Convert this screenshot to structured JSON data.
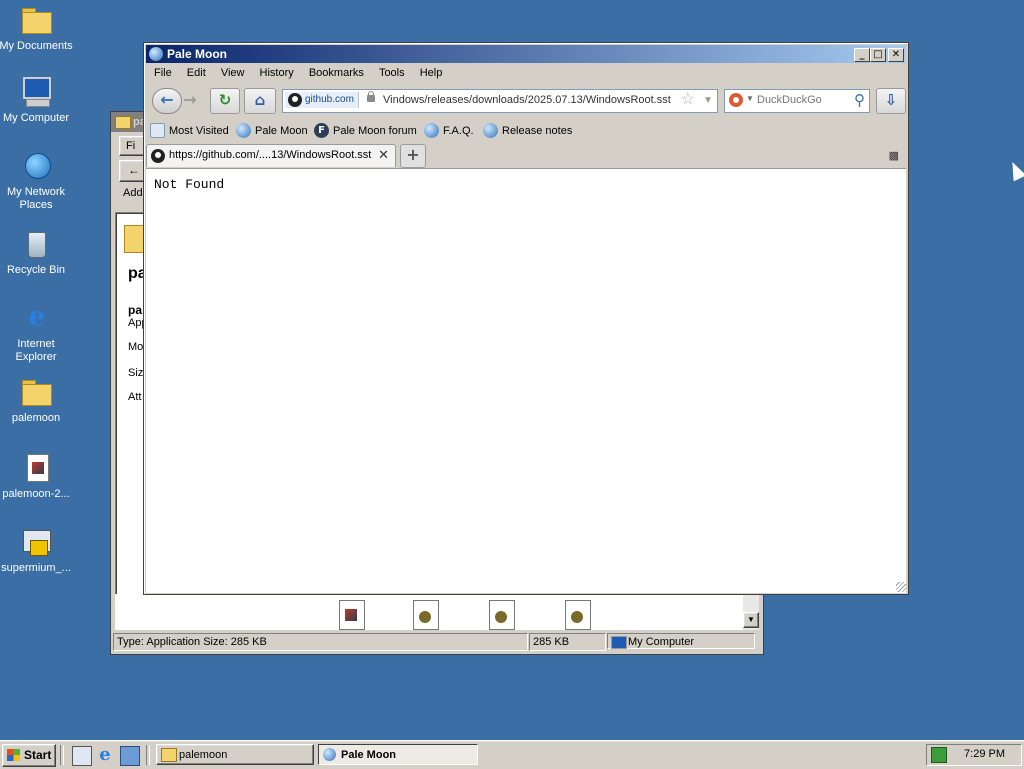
{
  "desktop": {
    "icons": [
      {
        "label": "My Documents",
        "icon": "my-documents-icon"
      },
      {
        "label": "My Computer",
        "icon": "my-computer-icon"
      },
      {
        "label": "My Network Places",
        "icon": "network-places-icon"
      },
      {
        "label": "Recycle Bin",
        "icon": "recycle-bin-icon"
      },
      {
        "label": "Internet Explorer",
        "icon": "internet-explorer-icon"
      },
      {
        "label": "palemoon",
        "icon": "folder-icon"
      },
      {
        "label": "palemoon-2...",
        "icon": "installer-icon"
      },
      {
        "label": "supermium_...",
        "icon": "setup-icon"
      }
    ]
  },
  "explorer": {
    "title": "pa",
    "menu_partial": "Fi",
    "address_partial": "Add",
    "left_pane": {
      "name_partial": "pa",
      "type_partial": "App",
      "modified_partial": "Mo",
      "size_partial": "Size",
      "attributes_partial": "Att"
    },
    "status": {
      "info": "Type: Application Size: 285 KB",
      "size": "285 KB",
      "zone": "My Computer"
    }
  },
  "browser": {
    "title": "Pale Moon",
    "menu": [
      "File",
      "Edit",
      "View",
      "History",
      "Bookmarks",
      "Tools",
      "Help"
    ],
    "url_site": "github.com",
    "url_path": "Vindows/releases/downloads/2025.07.13/WindowsRoot.sst",
    "search_placeholder": "DuckDuckGo",
    "bookmarks": [
      "Most Visited",
      "Pale Moon",
      "Pale Moon forum",
      "F.A.Q.",
      "Release notes"
    ],
    "tab_title": "https://github.com/....13/WindowsRoot.sst",
    "page_text": "Not Found",
    "colors": {
      "titlebar_start": "#0a246a",
      "titlebar_end": "#a6caf0"
    }
  },
  "taskbar": {
    "start_label": "Start",
    "tasks": [
      {
        "label": "palemoon",
        "active": false
      },
      {
        "label": "Pale Moon",
        "active": true
      }
    ],
    "clock": "7:29 PM"
  }
}
